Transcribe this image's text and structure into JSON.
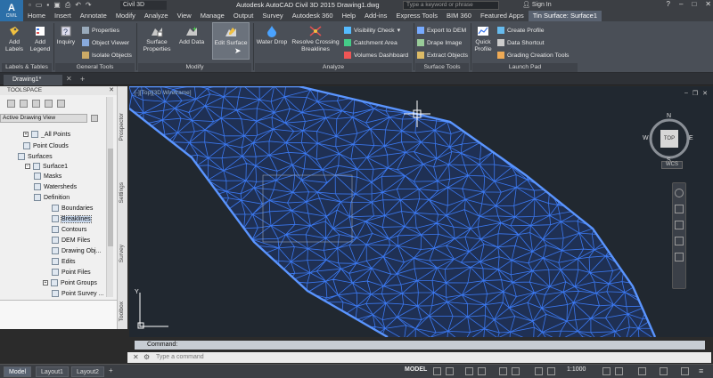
{
  "app": {
    "icon_label": "A",
    "icon_sub": "CIVIL",
    "workspace": "Civil 3D",
    "window_title": "Autodesk AutoCAD Civil 3D 2015   Drawing1.dwg",
    "search_placeholder": "Type a keyword or phrase",
    "sign_in": "Sign In"
  },
  "menu_tabs": [
    "Home",
    "Insert",
    "Annotate",
    "Modify",
    "Analyze",
    "View",
    "Manage",
    "Output",
    "Survey",
    "Autodesk 360",
    "Help",
    "Add-ins",
    "Express Tools",
    "BIM 360",
    "Featured Apps",
    "Tin Surface: Surface1"
  ],
  "ribbon": {
    "add_labels": "Add Labels",
    "add_legend": "Add Legend",
    "inquiry": "Inquiry",
    "properties": "Properties",
    "object_viewer": "Object Viewer",
    "isolate_objects": "Isolate Objects",
    "surface_properties": "Surface Properties",
    "add_data": "Add Data",
    "edit_surface": "Edit Surface",
    "water_drop": "Water Drop",
    "resolve_crossing": "Resolve Crossing Breaklines",
    "visibility_check": "Visibility Check",
    "catchment_area": "Catchment Area",
    "volumes_dashboard": "Volumes Dashboard",
    "export_dem": "Export to DEM",
    "drape_image": "Drape Image",
    "extract_objects": "Extract Objects",
    "quick_profile": "Quick Profile",
    "create_profile": "Create Profile",
    "data_shortcut": "Data Shortcut",
    "grading_tools": "Grading Creation Tools",
    "panels": [
      "Labels & Tables",
      "General Tools",
      "Modify",
      "Analyze",
      "Surface Tools",
      "Launch Pad"
    ]
  },
  "doc_tab": "Drawing1*",
  "toolspace": {
    "title": "TOOLSPACE",
    "view_select": "Active Drawing View",
    "tree": [
      "_All Points",
      "Point Clouds",
      "Surfaces",
      "Surface1",
      "Masks",
      "Watersheds",
      "Definition",
      "Boundaries",
      "Breaklines",
      "Contours",
      "DEM Files",
      "Drawing Obj...",
      "Edits",
      "Point Files",
      "Point Groups",
      "Point Survey ..."
    ],
    "vtabs": [
      "Prospector",
      "Settings",
      "Survey",
      "Toolbox"
    ]
  },
  "viewport": {
    "label": "[-][Top][3D Wireframe]",
    "cube_top": "TOP",
    "n": "N",
    "s": "S",
    "e": "E",
    "w": "W",
    "wcs": "WCS",
    "ucs_y": "Y"
  },
  "command": {
    "history": "Command:",
    "placeholder": "Type a command"
  },
  "status": {
    "tabs": [
      "Model",
      "Layout1",
      "Layout2"
    ],
    "model": "MODEL",
    "scale": "1:1000"
  },
  "colors": {
    "mesh": "#3b78f0",
    "background": "#212830",
    "ribbon": "#4a4f57"
  }
}
